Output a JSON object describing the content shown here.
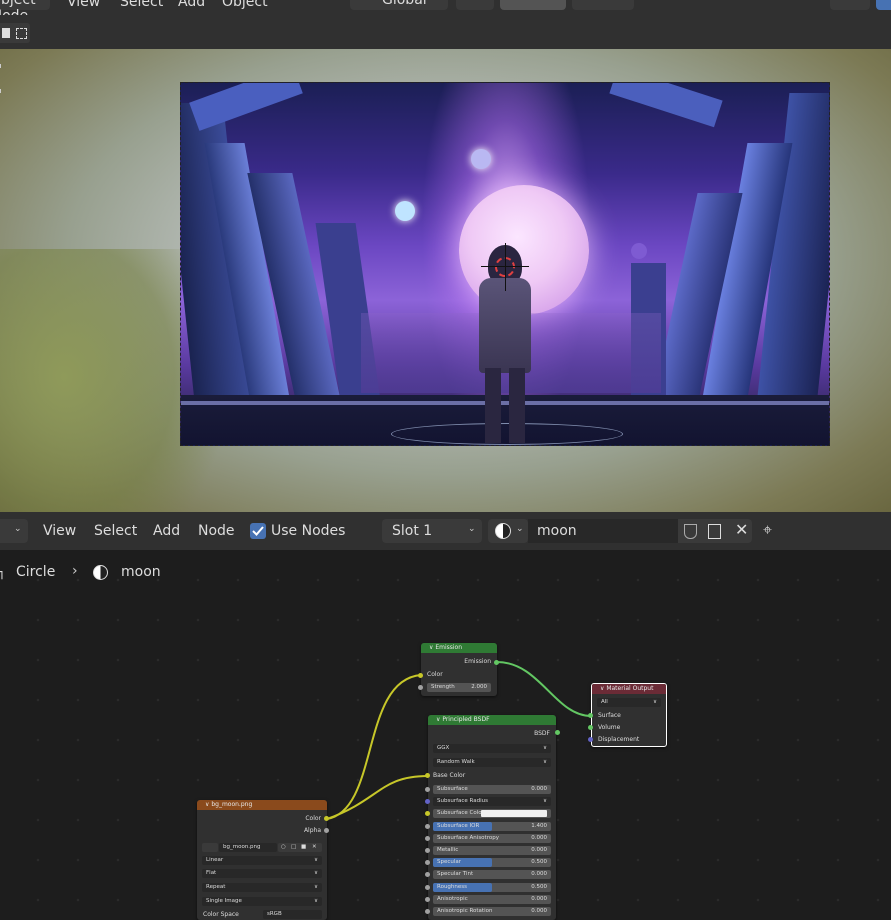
{
  "top_menu": {
    "mode_label": "Object Mode",
    "view": "View",
    "select": "Select",
    "add": "Add",
    "object": "Object",
    "orientation": "Global"
  },
  "node_header": {
    "view": "View",
    "select": "Select",
    "add": "Add",
    "node": "Node",
    "use_nodes": "Use Nodes",
    "slot": "Slot 1",
    "material_name": "moon"
  },
  "breadcrumb": {
    "object": "Circle",
    "material": "moon"
  },
  "nodes": {
    "emission": {
      "title": "Emission",
      "output": "Emission",
      "color": "Color",
      "strength_label": "Strength",
      "strength_value": "2.000"
    },
    "material_output": {
      "title": "Material Output",
      "target": "All",
      "surface": "Surface",
      "volume": "Volume",
      "displacement": "Displacement"
    },
    "principled": {
      "title": "Principled BSDF",
      "output": "BSDF",
      "distribution": "GGX",
      "subsurface_method": "Random Walk",
      "base_color": "Base Color",
      "fields": [
        {
          "label": "Subsurface",
          "value": "0.000",
          "fill": 0
        },
        {
          "label": "Subsurface Radius",
          "value": "",
          "fill": 0
        },
        {
          "label": "Subsurface Color",
          "value": "",
          "fill": 0
        },
        {
          "label": "Subsurface IOR",
          "value": "1.400",
          "fill": 0.5
        },
        {
          "label": "Subsurface Anisotropy",
          "value": "0.000",
          "fill": 0
        },
        {
          "label": "Metallic",
          "value": "0.000",
          "fill": 0
        },
        {
          "label": "Specular",
          "value": "0.500",
          "fill": 0.5
        },
        {
          "label": "Specular Tint",
          "value": "0.000",
          "fill": 0
        },
        {
          "label": "Roughness",
          "value": "0.500",
          "fill": 0.5
        },
        {
          "label": "Anisotropic",
          "value": "0.000",
          "fill": 0
        },
        {
          "label": "Anisotropic Rotation",
          "value": "0.000",
          "fill": 0
        }
      ]
    },
    "image": {
      "title": "bg_moon.png",
      "out_color": "Color",
      "out_alpha": "Alpha",
      "image_name": "bg_moon.png",
      "interpolation": "Linear",
      "projection": "Flat",
      "extension": "Repeat",
      "source": "Single Image",
      "colorspace_label": "Color Space",
      "colorspace_value": "sRGB"
    }
  },
  "colors": {
    "header_emission": "#2f7a34",
    "header_output": "#6b2b36",
    "header_principled": "#2f7a34",
    "header_image": "#8a4a1c",
    "accent": "#4772b3"
  }
}
